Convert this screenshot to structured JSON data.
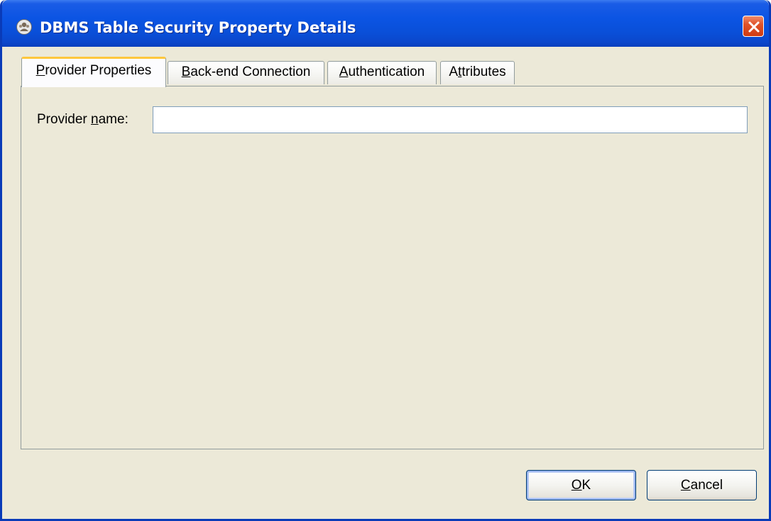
{
  "window": {
    "title": "DBMS Table Security Property Details",
    "icon": "user-icon",
    "close_icon": "close-icon"
  },
  "tabs": [
    {
      "label_pre": "",
      "label_u": "P",
      "label_post": "rovider Properties",
      "active": true
    },
    {
      "label_pre": "",
      "label_u": "B",
      "label_post": "ack-end Connection",
      "active": false
    },
    {
      "label_pre": "",
      "label_u": "A",
      "label_post": "uthentication",
      "active": false
    },
    {
      "label_pre": "A",
      "label_u": "t",
      "label_post": "tributes",
      "active": false
    }
  ],
  "provider_properties": {
    "name_label_pre": "Provider ",
    "name_label_u": "n",
    "name_label_post": "ame:",
    "name_value": ""
  },
  "buttons": {
    "ok_u": "O",
    "ok_post": "K",
    "cancel_u": "C",
    "cancel_post": "ancel"
  },
  "colors": {
    "titlebar": "#0b54e3",
    "dialog_bg": "#ece9d8",
    "active_tab_accent": "#ffc73c",
    "close_button": "#e0532a"
  }
}
